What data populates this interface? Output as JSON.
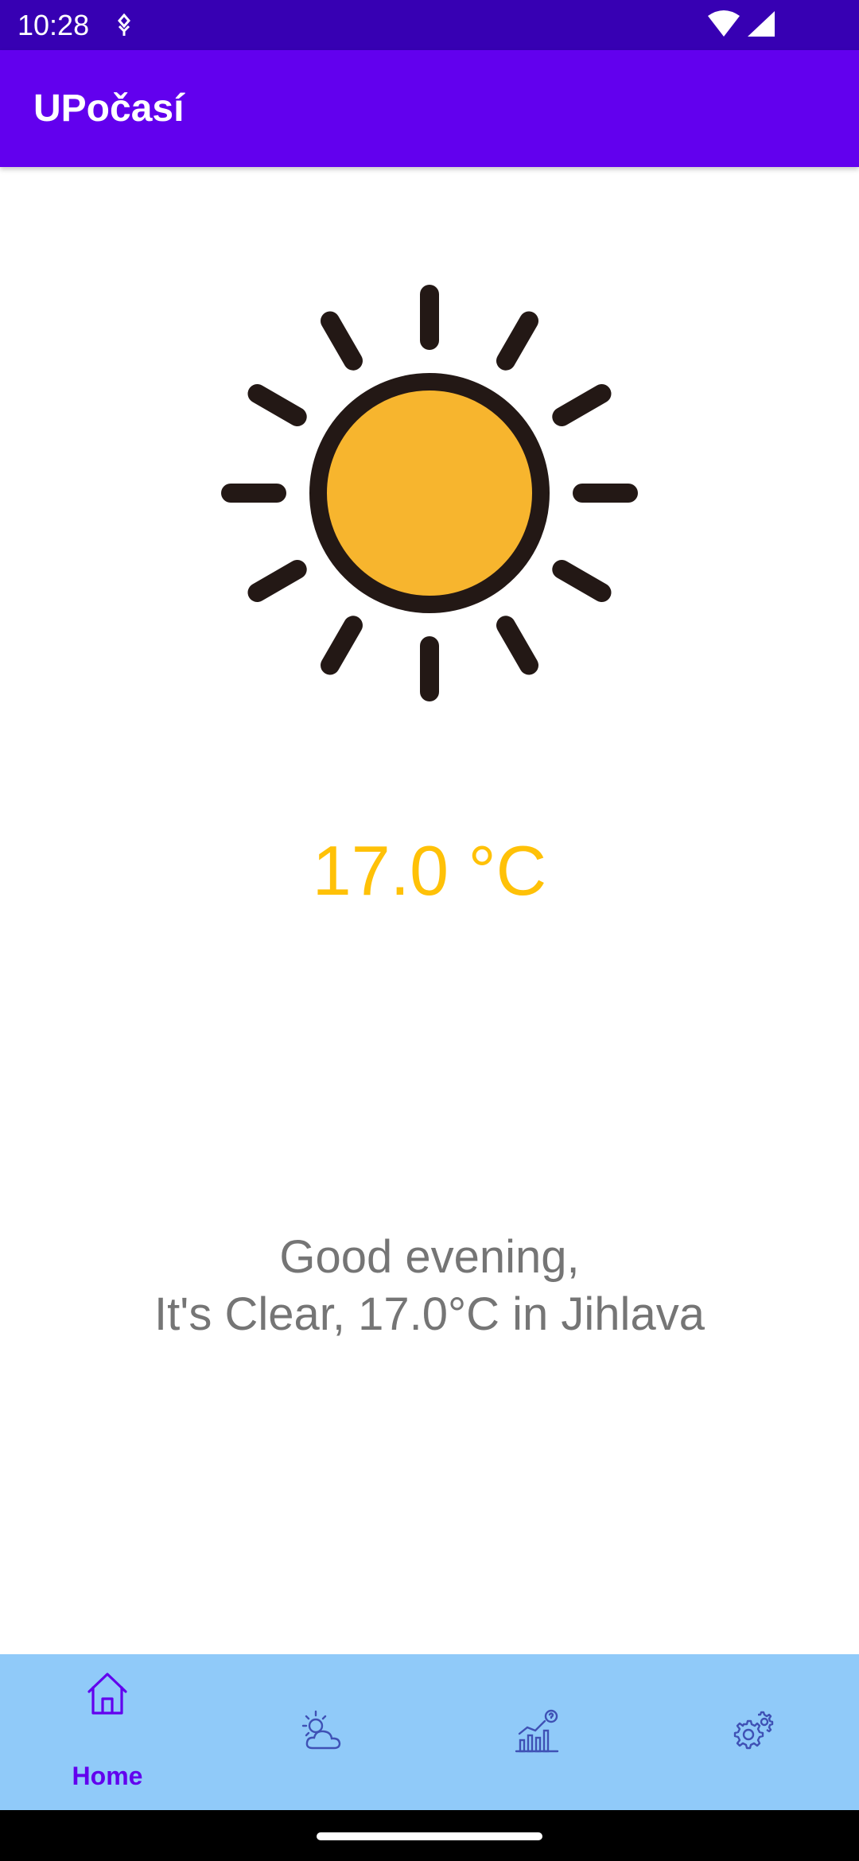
{
  "status_bar": {
    "time": "10:28",
    "icons": [
      "notification-icon",
      "wifi-icon",
      "signal-icon"
    ]
  },
  "app_bar": {
    "title": "UPočasí"
  },
  "weather": {
    "icon": "sun-icon",
    "temperature": "17.0 °C",
    "greeting_line1": "Good evening,",
    "greeting_line2": "It's Clear, 17.0°C in Jihlava"
  },
  "bottom_nav": {
    "items": [
      {
        "icon": "home-icon",
        "label": "Home",
        "selected": true
      },
      {
        "icon": "weather-forecast-icon",
        "label": "",
        "selected": false
      },
      {
        "icon": "statistics-icon",
        "label": "",
        "selected": false
      },
      {
        "icon": "settings-icon",
        "label": "",
        "selected": false
      }
    ]
  },
  "colors": {
    "status_bar": "#3700B3",
    "app_bar": "#6200EE",
    "temperature": "#FFC107",
    "sun_fill": "#F7B52E",
    "sun_outline": "#231815",
    "bottom_nav": "#90CAF9",
    "nav_selected": "#6200EE",
    "nav_unselected": "#3F51B5"
  }
}
